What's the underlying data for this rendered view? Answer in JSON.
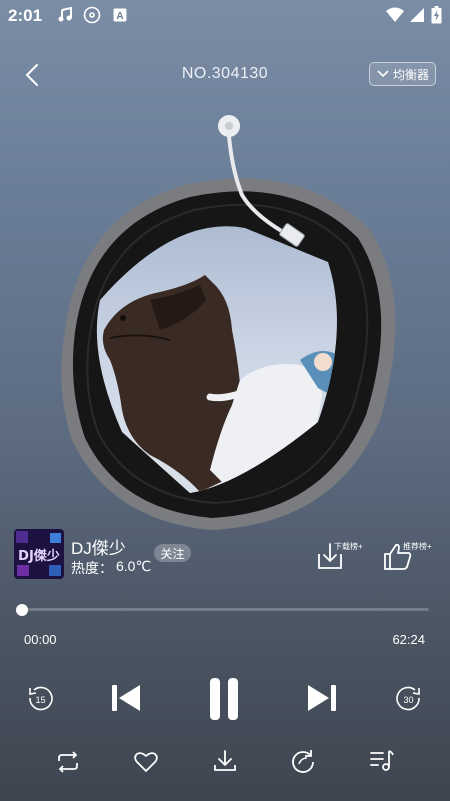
{
  "status_bar": {
    "time": "2:01",
    "icons": [
      "music-note-icon",
      "disc-icon",
      "a-badge-icon",
      "wifi-icon",
      "signal-icon",
      "battery-charging-icon"
    ]
  },
  "header": {
    "back_icon": "chevron-left-icon",
    "title": "NO.304130",
    "eq_label": "均衡器"
  },
  "artist": {
    "name": "DJ傑少",
    "heat_label": "热度：",
    "heat_value": "6.0℃",
    "follow_label": "关注",
    "avatar_text": "DJ傑少"
  },
  "actions": {
    "download_chart": "下载榜+",
    "recommend_chart": "推荐榜+"
  },
  "progress": {
    "current": "00:00",
    "total": "62:24",
    "fraction": 0.0
  },
  "controls": {
    "rewind_seconds": "15",
    "forward_seconds": "30",
    "state": "playing"
  },
  "colors": {
    "accent": "#ffffff",
    "bg_top": "#7b8da5",
    "bg_bottom": "#3e4550"
  }
}
